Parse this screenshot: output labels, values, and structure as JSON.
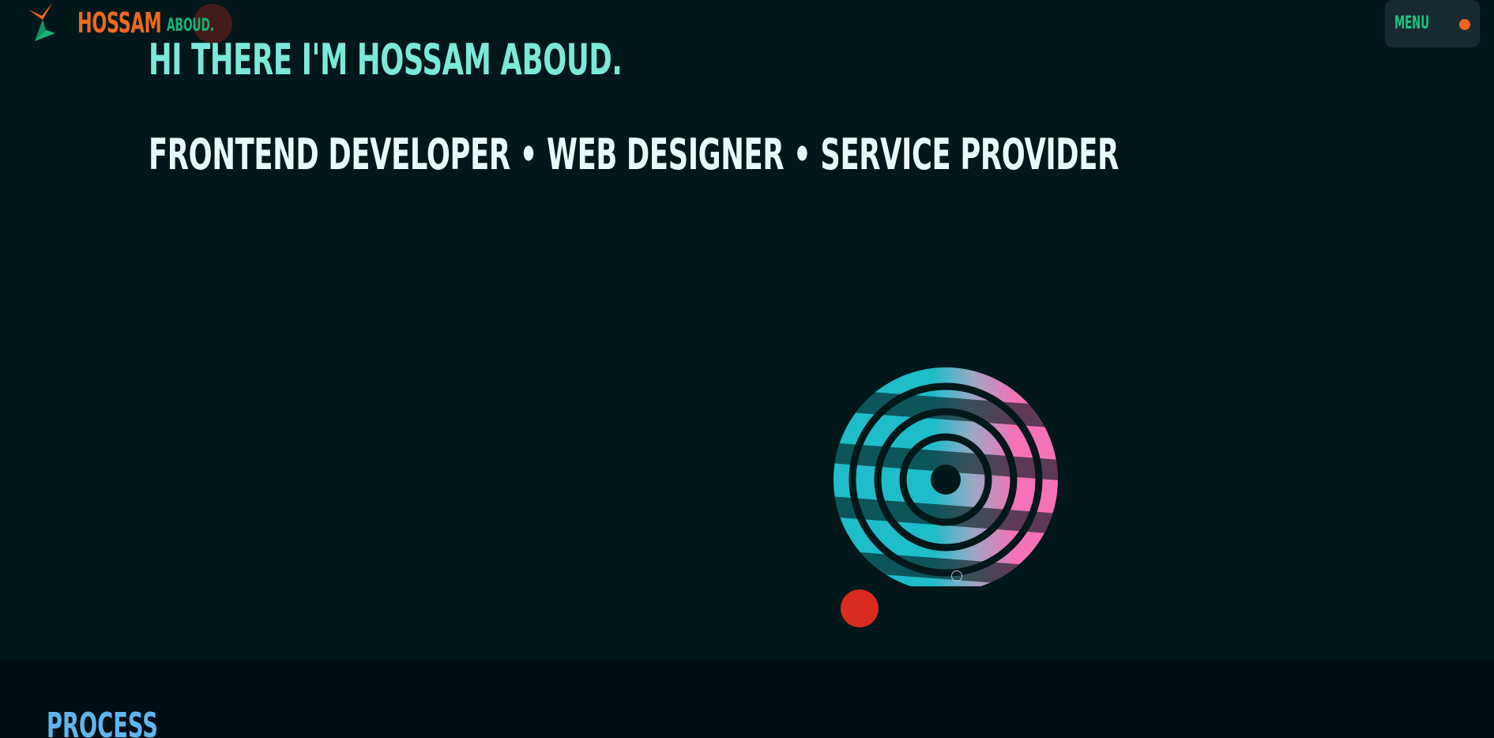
{
  "header": {
    "logo_icon": "bolt-logo-icon",
    "brand_first": "HOSSAM",
    "brand_last": "ABOUD.",
    "menu_label": "MENU"
  },
  "hero": {
    "greeting": "HI THERE I'M HOSSAM ABOUD.",
    "roles": "FRONTEND DEVELOPER • WEB DESIGNER • SERVICE PROVIDER",
    "graphic": "striped-target-graphic"
  },
  "process": {
    "title": "PROCESS"
  },
  "colors": {
    "background": "#021719",
    "section_background": "#010f14",
    "brand_orange": "#ee6a1f",
    "brand_green": "#16b478",
    "greeting_mint": "#7be9da",
    "roles_text": "#e6fbf8",
    "menu_bg": "#172a31",
    "menu_text": "#1ec57e",
    "menu_dot": "#f0631c",
    "accent_red": "#d92b20",
    "process_blue": "#5fb6ee",
    "target_cyan": "#1fbcc9",
    "target_pink": "#f572b8"
  }
}
